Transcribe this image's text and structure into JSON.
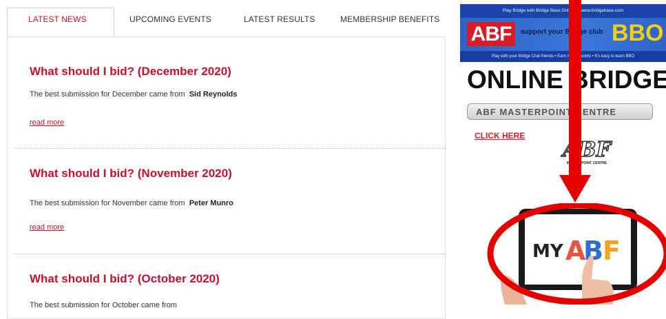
{
  "tabs": [
    {
      "label": "LATEST NEWS",
      "active": true
    },
    {
      "label": "UPCOMING EVENTS",
      "active": false
    },
    {
      "label": "LATEST RESULTS",
      "active": false
    },
    {
      "label": "MEMBERSHIP BENEFITS",
      "active": false
    }
  ],
  "articles": [
    {
      "title": "What should I bid? (December 2020)",
      "summary_prefix": "The best submission for December came from",
      "winner": "Sid Reynolds",
      "link": "read more"
    },
    {
      "title": "What should I bid? (November 2020)",
      "summary_prefix": "The best submission for November came from",
      "winner": "Peter Munro",
      "link": "read more"
    },
    {
      "title": "What should I bid? (October 2020)",
      "summary_prefix": "The best submission for October came from",
      "winner": "",
      "link": ""
    }
  ],
  "sidebar": {
    "ad": {
      "top_line": "Play Bridge with Bridge Base Online at www.bridgebase.com",
      "abf": "ABF",
      "support": "support your Bridge club",
      "bbo": "BBO",
      "bottom_line": "Play with your Bridge Club friends • Earn masterpoints • It's easy to learn BBO"
    },
    "online_bridge_title": "ONLINE BRIDGE",
    "masterpoint_centre": "ABF MASTERPOINT CENTRE",
    "click_here": "CLICK HERE",
    "abf_logo_text": "ABF",
    "abf_logo_sub": "MASTERPOINT CENTRE",
    "myabf": {
      "my": "MY",
      "a": "A",
      "b": "B",
      "f": "F"
    }
  },
  "colors": {
    "accent_red": "#c8102e",
    "annotation_red": "#e50000",
    "abf_a": "#e8543f",
    "abf_b": "#2f6fd0",
    "abf_f": "#f3a21b"
  }
}
